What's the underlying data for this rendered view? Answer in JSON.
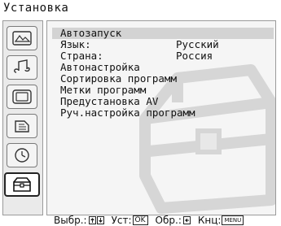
{
  "title": "Установка",
  "sidebar": {
    "items": [
      {
        "icon": "picture-icon"
      },
      {
        "icon": "sound-icon"
      },
      {
        "icon": "screen-icon"
      },
      {
        "icon": "features-icon"
      },
      {
        "icon": "timer-icon"
      },
      {
        "icon": "setup-icon"
      }
    ],
    "active_index": 5
  },
  "menu": {
    "items": [
      {
        "label": "Автозапуск",
        "value": ""
      },
      {
        "label": "Язык:",
        "value": "Русский"
      },
      {
        "label": "Страна:",
        "value": "Россия"
      },
      {
        "label": "Автонастройка",
        "value": ""
      },
      {
        "label": "Сортировка программ",
        "value": ""
      },
      {
        "label": "Метки программ",
        "value": ""
      },
      {
        "label": "Предустановка AV",
        "value": ""
      },
      {
        "label": "Руч.настройка программ",
        "value": ""
      }
    ],
    "selected_index": 0
  },
  "footer": {
    "select_label": "Выбр.:",
    "set_label": "Уст:",
    "set_key": "OK",
    "back_label": "Обр.:",
    "exit_label": "Кнц:",
    "exit_key": "MENU"
  },
  "colors": {
    "panel_bg": "#f5f5f5",
    "highlight": "#d3d3d3",
    "watermark": "#d9d9d9"
  }
}
